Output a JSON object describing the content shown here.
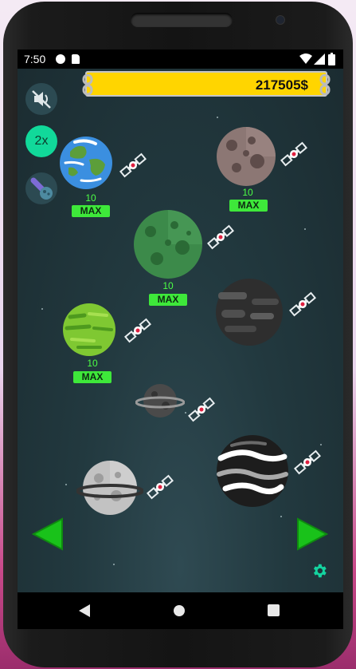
{
  "status": {
    "time": "7:50"
  },
  "game": {
    "money": "217505$",
    "speed_label": "2x",
    "planets": [
      {
        "name": "earth",
        "level": "10",
        "badge": "MAX"
      },
      {
        "name": "rocky-brown",
        "level": "10",
        "badge": "MAX"
      },
      {
        "name": "green-cratered",
        "level": "10",
        "badge": "MAX"
      },
      {
        "name": "dark-striped",
        "level": "",
        "badge": ""
      },
      {
        "name": "green-striped",
        "level": "10",
        "badge": "MAX"
      },
      {
        "name": "small-ringed",
        "level": "",
        "badge": ""
      },
      {
        "name": "black-white-swirl",
        "level": "",
        "badge": ""
      },
      {
        "name": "grey-ringed",
        "level": "",
        "badge": ""
      }
    ]
  },
  "colors": {
    "money_bar": "#ffd500",
    "accent_green": "#3ee83a",
    "arrow_green": "#19c21a",
    "settings": "#14d4a0"
  },
  "icons": [
    "mute-icon",
    "rocket-boost-icon",
    "satellite-icon",
    "left-arrow-icon",
    "right-arrow-icon",
    "settings-gear-icon",
    "wifi-icon",
    "signal-icon",
    "battery-icon",
    "back-icon",
    "home-icon",
    "recents-icon"
  ]
}
